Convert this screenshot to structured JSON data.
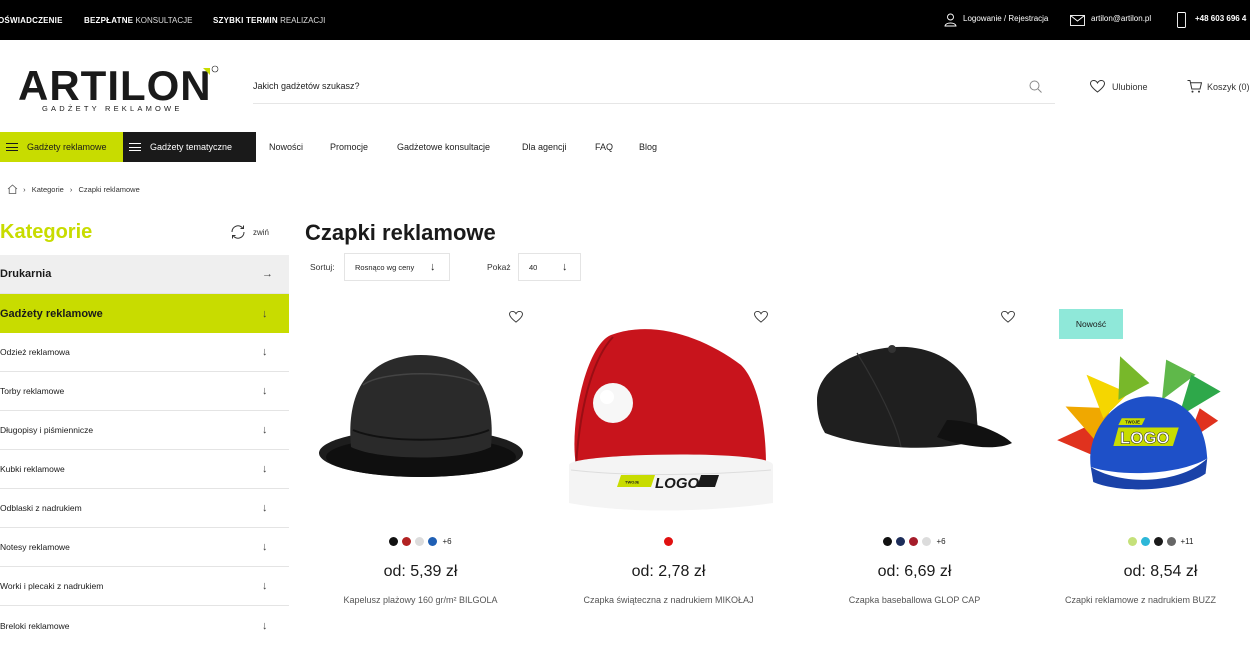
{
  "topbar": {
    "promo1_bold": "OŚWIADCZENIE",
    "promo2_bold": "BEZPŁATNE",
    "promo2_thin": "KONSULTACJE",
    "promo3_bold": "SZYBKI TERMIN",
    "promo3_thin": "REALIZACJI",
    "login": "Logowanie / Rejestracja",
    "email": "artilon@artilon.pl",
    "phone": "+48 603 696 4"
  },
  "header": {
    "logo_text": "ARTILON",
    "logo_sub": "GADŻETY REKLAMOWE",
    "search_placeholder": "Jakich gadżetów szukasz?",
    "favorites": "Ulubione",
    "cart": "Koszyk (0)"
  },
  "nav": {
    "btn_green": "Gadżety reklamowe",
    "btn_dark": "Gadżety tematyczne",
    "links": [
      "Nowości",
      "Promocje",
      "Gadżetowe konsultacje",
      "Dla agencji",
      "FAQ",
      "Blog"
    ]
  },
  "breadcrumb": [
    "Kategorie",
    "Czapki reklamowe"
  ],
  "sidebar": {
    "title": "Kategorie",
    "toggle": "zwiń",
    "items": [
      {
        "label": "Drukarnia"
      },
      {
        "label": "Gadżety reklamowe"
      },
      {
        "label": "Odzież reklamowa"
      },
      {
        "label": "Torby reklamowe"
      },
      {
        "label": "Długopisy i piśmiennicze"
      },
      {
        "label": "Kubki reklamowe"
      },
      {
        "label": "Odblaski z nadrukiem"
      },
      {
        "label": "Notesy reklamowe"
      },
      {
        "label": "Worki i plecaki z nadrukiem"
      },
      {
        "label": "Breloki reklamowe"
      }
    ]
  },
  "main": {
    "title": "Czapki reklamowe",
    "sort_label": "Sortuj:",
    "sort_value": "Rosnąco wg ceny",
    "show_label": "Pokaż",
    "show_value": "40"
  },
  "products": [
    {
      "name": "Kapelusz plażowy 160 gr/m² BILGOLA",
      "price": "od: 5,39 zł",
      "swatches": [
        "#111111",
        "#b22222",
        "#dcdcdc",
        "#1f5fb4"
      ],
      "more": "+6",
      "badge": ""
    },
    {
      "name": "Czapka świąteczna z nadrukiem MIKOŁAJ",
      "price": "od: 2,78 zł",
      "swatches": [
        "#e01010"
      ],
      "more": "",
      "badge": ""
    },
    {
      "name": "Czapka baseballowa GLOP CAP",
      "price": "od: 6,69 zł",
      "swatches": [
        "#111111",
        "#1d2d5a",
        "#a51c2a",
        "#dcdcdc"
      ],
      "more": "+6",
      "badge": ""
    },
    {
      "name": "Czapki reklamowe z nadrukiem BUZZ",
      "price": "od: 8,54 zł",
      "swatches": [
        "#c5e17a",
        "#2db7d8",
        "#1a1a1a",
        "#666666"
      ],
      "more": "+11",
      "badge": "Nowość"
    }
  ],
  "logo_print": {
    "small": "TWOJE",
    "big": "LOGO"
  },
  "colors": {
    "accent": "#c8dc00",
    "badge": "#8fe8d9",
    "dark": "#1a1a1a"
  }
}
